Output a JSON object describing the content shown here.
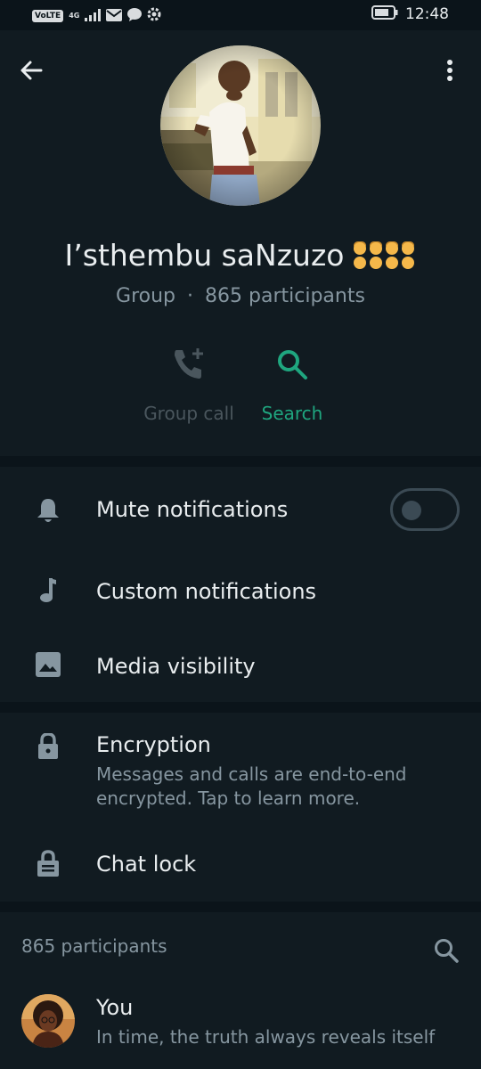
{
  "status_bar": {
    "left_badges": [
      "VoLTE",
      "4G"
    ],
    "time": "12:48"
  },
  "group": {
    "name": "I’sthembu saNzuzo",
    "type": "Group",
    "separator": "·",
    "participants_text": "865 participants"
  },
  "actions": {
    "call_label": "Group call",
    "search_label": "Search"
  },
  "settings": {
    "mute": {
      "label": "Mute notifications",
      "enabled": false
    },
    "custom": {
      "label": "Custom notifications"
    },
    "media": {
      "label": "Media visibility"
    }
  },
  "security": {
    "encryption": {
      "label": "Encryption",
      "description": "Messages and calls are end-to-end encrypted. Tap to learn more."
    },
    "chatlock": {
      "label": "Chat lock"
    }
  },
  "participants": {
    "header": "865 participants",
    "members": [
      {
        "name": "You",
        "status": "In time, the truth always reveals itself"
      }
    ]
  },
  "colors": {
    "background": "#0b141a",
    "panel": "#111b21",
    "accent": "#1fa67f",
    "muted": "#8696a0",
    "text": "#e9edef"
  },
  "icons": [
    "back-arrow-icon",
    "more-vert-icon",
    "add-call-icon",
    "search-icon",
    "bell-icon",
    "music-note-icon",
    "image-icon",
    "lock-icon",
    "chat-lock-icon"
  ]
}
